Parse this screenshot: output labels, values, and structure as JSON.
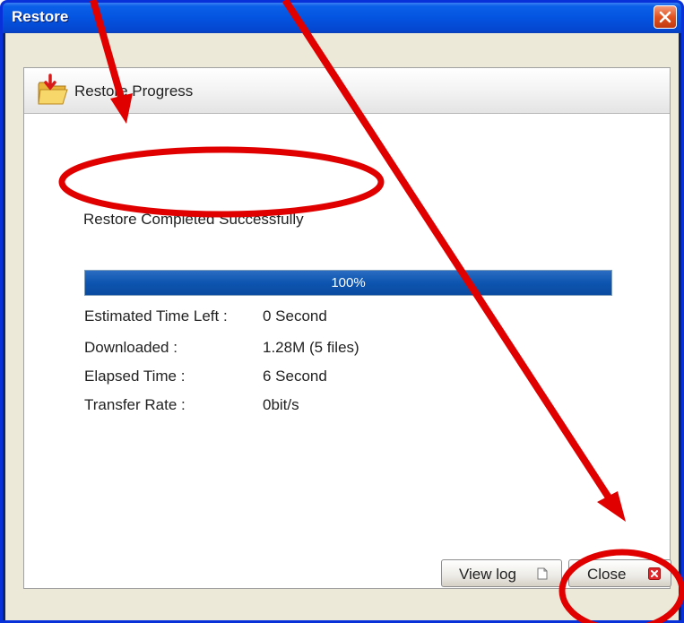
{
  "window": {
    "title": "Restore"
  },
  "panel": {
    "title": "Restore Progress",
    "status_message": "Restore Completed Successfully"
  },
  "progress": {
    "percent_text": "100%",
    "fraction": 1.0
  },
  "stats": [
    {
      "label": "Estimated Time Left :",
      "value": "0 Second"
    },
    {
      "label": "Downloaded :",
      "value": "1.28M (5 files)"
    },
    {
      "label": "Elapsed Time :",
      "value": "6 Second"
    },
    {
      "label": "Transfer Rate :",
      "value": "0bit/s"
    }
  ],
  "buttons": {
    "view_log": "View log",
    "close": "Close"
  },
  "icons": {
    "panel": "folder-download-icon",
    "view_log": "document-icon",
    "close": "close-red-icon",
    "title_close": "window-close-icon"
  },
  "colors": {
    "titlebar": "#0454e0",
    "progress_fill": "#0d55b0",
    "annotation": "#e00000"
  }
}
